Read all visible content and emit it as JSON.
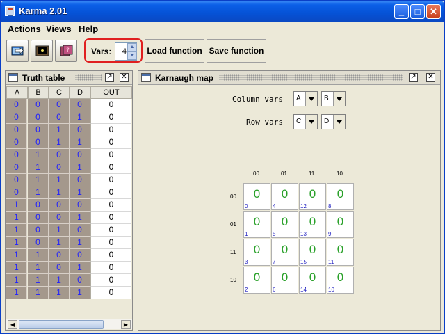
{
  "window": {
    "title": "Karma 2.01"
  },
  "menu": [
    {
      "label": "Actions"
    },
    {
      "label": "Views"
    },
    {
      "label": "Help"
    }
  ],
  "toolbar": {
    "vars_label": "Vars:",
    "vars_value": "4",
    "load_label": "Load function",
    "save_label": "Save function"
  },
  "truth_table": {
    "title": "Truth table",
    "headers": [
      "A",
      "B",
      "C",
      "D",
      "OUT"
    ],
    "rows": [
      [
        "0",
        "0",
        "0",
        "0",
        "0"
      ],
      [
        "0",
        "0",
        "0",
        "1",
        "0"
      ],
      [
        "0",
        "0",
        "1",
        "0",
        "0"
      ],
      [
        "0",
        "0",
        "1",
        "1",
        "0"
      ],
      [
        "0",
        "1",
        "0",
        "0",
        "0"
      ],
      [
        "0",
        "1",
        "0",
        "1",
        "0"
      ],
      [
        "0",
        "1",
        "1",
        "0",
        "0"
      ],
      [
        "0",
        "1",
        "1",
        "1",
        "0"
      ],
      [
        "1",
        "0",
        "0",
        "0",
        "0"
      ],
      [
        "1",
        "0",
        "0",
        "1",
        "0"
      ],
      [
        "1",
        "0",
        "1",
        "0",
        "0"
      ],
      [
        "1",
        "0",
        "1",
        "1",
        "0"
      ],
      [
        "1",
        "1",
        "0",
        "0",
        "0"
      ],
      [
        "1",
        "1",
        "0",
        "1",
        "0"
      ],
      [
        "1",
        "1",
        "1",
        "0",
        "0"
      ],
      [
        "1",
        "1",
        "1",
        "1",
        "0"
      ]
    ]
  },
  "kmap": {
    "title": "Karnaugh map",
    "column_vars_label": "Column vars",
    "row_vars_label": "Row vars",
    "column_var_1": "A",
    "column_var_2": "B",
    "row_var_1": "C",
    "row_var_2": "D",
    "col_headers": [
      "00",
      "01",
      "11",
      "10"
    ],
    "row_headers": [
      "00",
      "01",
      "11",
      "10"
    ],
    "cells": [
      [
        {
          "value": "0",
          "index": "0"
        },
        {
          "value": "0",
          "index": "4"
        },
        {
          "value": "0",
          "index": "12"
        },
        {
          "value": "0",
          "index": "8"
        }
      ],
      [
        {
          "value": "0",
          "index": "1"
        },
        {
          "value": "0",
          "index": "5"
        },
        {
          "value": "0",
          "index": "13"
        },
        {
          "value": "0",
          "index": "9"
        }
      ],
      [
        {
          "value": "0",
          "index": "3"
        },
        {
          "value": "0",
          "index": "7"
        },
        {
          "value": "0",
          "index": "15"
        },
        {
          "value": "0",
          "index": "11"
        }
      ],
      [
        {
          "value": "0",
          "index": "2"
        },
        {
          "value": "0",
          "index": "6"
        },
        {
          "value": "0",
          "index": "14"
        },
        {
          "value": "0",
          "index": "10"
        }
      ]
    ]
  },
  "colors": {
    "titlebar": "#0552d6",
    "input_cell_bg": "#a4988c",
    "input_digit": "#2020ff",
    "kmap_value": "#28a028",
    "kmap_index": "#2020c0",
    "highlight": "#e02020"
  }
}
